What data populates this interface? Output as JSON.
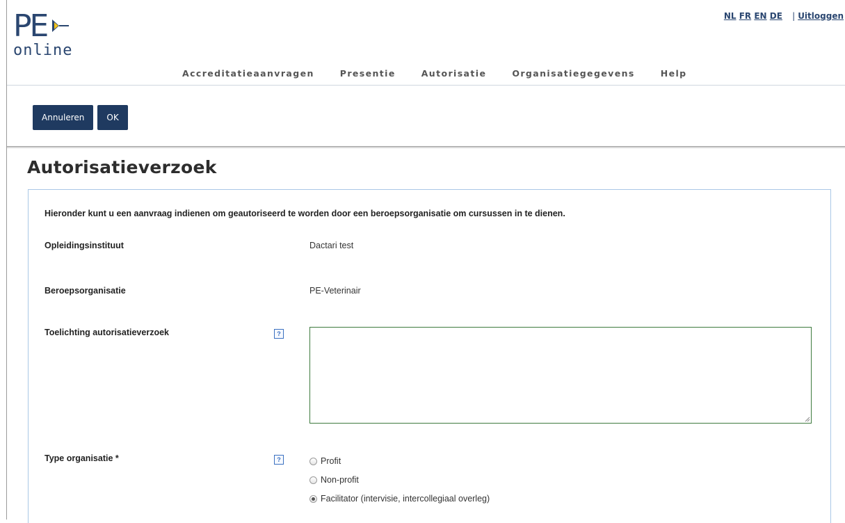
{
  "logo": {
    "mark": "PE",
    "sub": "online"
  },
  "languages": [
    "NL",
    "FR",
    "EN",
    "DE"
  ],
  "logout": "Uitloggen",
  "nav": [
    "Accreditatieaanvragen",
    "Presentie",
    "Autorisatie",
    "Organisatiegegevens",
    "Help"
  ],
  "toolbar": {
    "cancel": "Annuleren",
    "ok": "OK"
  },
  "page_title": "Autorisatieverzoek",
  "intro": "Hieronder kunt u een aanvraag indienen om geautoriseerd te worden door een beroepsorganisatie om cursussen in te dienen.",
  "fields": {
    "institute_label": "Opleidingsinstituut",
    "institute_value": "Dactari test",
    "profession_label": "Beroepsorganisatie",
    "profession_value": "PE-Veterinair",
    "explanation_label": "Toelichting autorisatieverzoek",
    "explanation_value": "",
    "type_label": "Type organisatie *"
  },
  "help_glyph": "?",
  "type_options": [
    {
      "label": "Profit",
      "checked": false
    },
    {
      "label": "Non-profit",
      "checked": false
    },
    {
      "label": "Facilitator (intervisie, intercollegiaal overleg)",
      "checked": true
    }
  ],
  "colors": {
    "brand": "#2a4670",
    "button": "#1f3a60",
    "panel_border": "#a9c7e6",
    "textarea_border": "#3d7a3d"
  }
}
